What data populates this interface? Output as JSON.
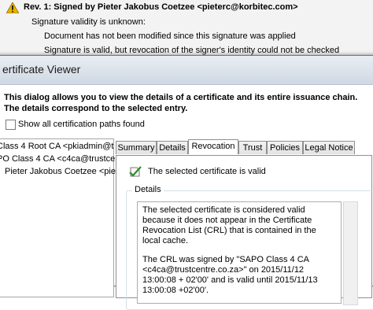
{
  "signature": {
    "title": "Rev. 1: Signed by Pieter Jakobus Coetzee <pieterc@korbitec.com>",
    "validity_unknown": "Signature validity is unknown:",
    "not_modified": "Document has not been modified since this signature was applied",
    "revocation_note": "Signature is valid, but revocation of the signer's identity could not be checked"
  },
  "viewer": {
    "title": "ertificate Viewer",
    "intro": "This dialog allows you to view the details of a certificate and its entire issuance chain. The details correspond to the selected entry.",
    "show_all_label": "Show all certification paths found",
    "tree": [
      "Class 4 Root CA <pkiadmin@t",
      "PO Class 4 CA <c4ca@trustcer",
      "Pieter Jakobus Coetzee <pieter"
    ],
    "tabs": [
      "Summary",
      "Details",
      "Revocation",
      "Trust",
      "Policies",
      "Legal Notice"
    ],
    "active_tab": "Revocation",
    "status": "The selected certificate is valid",
    "details_label": "Details",
    "details_text": [
      "The selected certificate is considered valid because it does not appear in the Certificate Revocation List (CRL) that is contained in the local cache.",
      "The CRL was signed by \"SAPO Class 4 CA <c4ca@trustcentre.co.za>\" on 2015/11/12 13:00:08 + 02'00' and is valid until 2015/11/13 13:00:08 +02'00'."
    ]
  },
  "colors": {
    "warning": "#e6b400",
    "titlebar": "#cfd8e3",
    "valid_check": "#2e8b2e"
  }
}
